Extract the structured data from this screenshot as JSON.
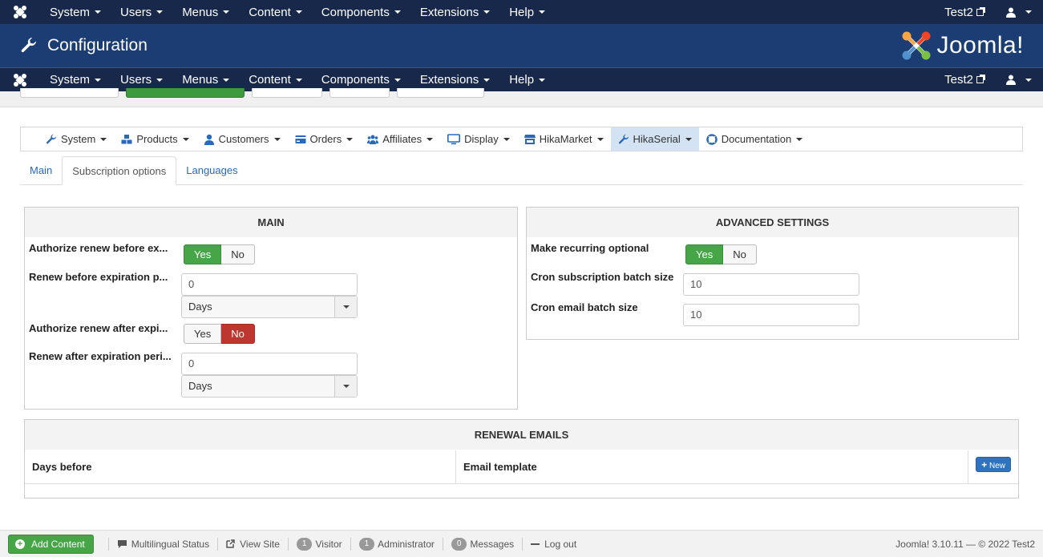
{
  "nav": {
    "items": [
      "System",
      "Users",
      "Menus",
      "Content",
      "Components",
      "Extensions",
      "Help"
    ],
    "user_site": "Test2"
  },
  "header": {
    "title": "Configuration",
    "brand": "Joomla!"
  },
  "hika_menu": {
    "items": [
      {
        "label": "System",
        "icon": "wrench-icon"
      },
      {
        "label": "Products",
        "icon": "cubes-icon"
      },
      {
        "label": "Customers",
        "icon": "user-icon"
      },
      {
        "label": "Orders",
        "icon": "credit-card-icon"
      },
      {
        "label": "Affiliates",
        "icon": "users-icon"
      },
      {
        "label": "Display",
        "icon": "monitor-icon"
      },
      {
        "label": "HikaMarket",
        "icon": "store-icon"
      },
      {
        "label": "HikaSerial",
        "icon": "key-icon",
        "active": true
      },
      {
        "label": "Documentation",
        "icon": "life-ring-icon"
      }
    ]
  },
  "tabs": [
    "Main",
    "Subscription options",
    "Languages"
  ],
  "active_tab": "Subscription options",
  "main_panel": {
    "title": "MAIN",
    "authorize_renew_before_label": "Authorize renew before ex...",
    "authorize_renew_before": "Yes",
    "renew_before_period_label": "Renew before expiration p...",
    "renew_before_period_value": "0",
    "renew_before_period_unit": "Days",
    "authorize_renew_after_label": "Authorize renew after expi...",
    "authorize_renew_after": "No",
    "renew_after_period_label": "Renew after expiration peri...",
    "renew_after_period_value": "0",
    "renew_after_period_unit": "Days"
  },
  "advanced_panel": {
    "title": "ADVANCED SETTINGS",
    "make_recurring_optional_label": "Make recurring optional",
    "make_recurring_optional": "Yes",
    "cron_subscription_batch_size_label": "Cron subscription batch size",
    "cron_subscription_batch_size": "10",
    "cron_email_batch_size_label": "Cron email batch size",
    "cron_email_batch_size": "10"
  },
  "renewal_emails": {
    "title": "RENEWAL EMAILS",
    "columns": [
      "Days before",
      "Email template"
    ],
    "new_button": "New"
  },
  "toggle_labels": {
    "yes": "Yes",
    "no": "No"
  },
  "statusbar": {
    "add_content": "Add Content",
    "multilingual_status": "Multilingual Status",
    "view_site": "View Site",
    "visitor_count": "1",
    "visitor_label": "Visitor",
    "admin_count": "1",
    "admin_label": "Administrator",
    "messages_count": "0",
    "messages_label": "Messages",
    "logout": "Log out",
    "version": "Joomla! 3.10.11  —  © 2022 Test2"
  },
  "colors": {
    "navbar": "#17284a",
    "header": "#1c3d73",
    "yes_active": "#46a546",
    "no_active": "#bd362f",
    "link": "#2a69b8"
  }
}
